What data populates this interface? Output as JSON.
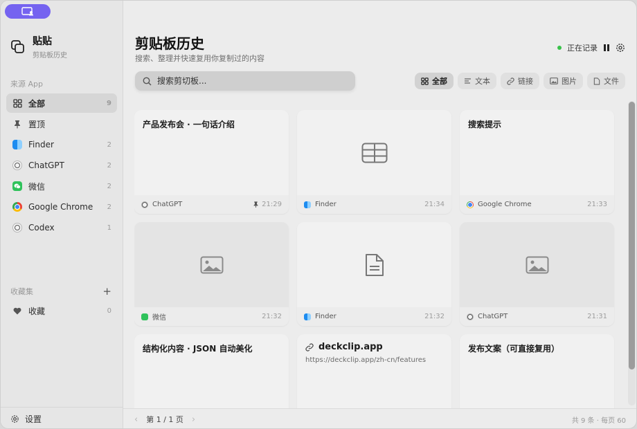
{
  "sidebar": {
    "brand": {
      "title": "贴贴",
      "subtitle": "剪贴板历史"
    },
    "sources_label": "来源 App",
    "items": [
      {
        "label": "全部",
        "count": "9",
        "icon": "grid-icon"
      },
      {
        "label": "置顶",
        "count": "",
        "icon": "pin-icon"
      },
      {
        "label": "Finder",
        "count": "2",
        "icon": "finder-icon"
      },
      {
        "label": "ChatGPT",
        "count": "2",
        "icon": "chatgpt-icon"
      },
      {
        "label": "微信",
        "count": "2",
        "icon": "wechat-icon"
      },
      {
        "label": "Google Chrome",
        "count": "2",
        "icon": "chrome-icon"
      },
      {
        "label": "Codex",
        "count": "1",
        "icon": "codex-icon"
      }
    ],
    "collections_label": "收藏集",
    "collections": [
      {
        "label": "收藏",
        "count": "0",
        "icon": "heart-icon"
      }
    ],
    "settings_label": "设置"
  },
  "header": {
    "title": "剪贴板历史",
    "subtitle": "搜索、整理并快速复用你复制过的内容",
    "status": "正在记录"
  },
  "search": {
    "placeholder": "搜索剪切板..."
  },
  "filters": [
    {
      "label": "全部",
      "icon": "grid-icon"
    },
    {
      "label": "文本",
      "icon": "text-icon"
    },
    {
      "label": "链接",
      "icon": "link-icon"
    },
    {
      "label": "图片",
      "icon": "image-icon"
    },
    {
      "label": "文件",
      "icon": "file-icon"
    }
  ],
  "cards": [
    {
      "title": "产品发布会 · 一句话介绍",
      "app": "ChatGPT",
      "time": "21:29",
      "pinned": true
    },
    {
      "title": "",
      "app": "Finder",
      "time": "21:34",
      "preview": "table-icon"
    },
    {
      "title": "搜索提示",
      "app": "Google Chrome",
      "time": "21:33"
    },
    {
      "title": "",
      "app": "微信",
      "time": "21:32",
      "preview": "image-icon"
    },
    {
      "title": "",
      "app": "Finder",
      "time": "21:32",
      "preview": "document-icon"
    },
    {
      "title": "",
      "app": "ChatGPT",
      "time": "21:31",
      "preview": "image-icon"
    },
    {
      "title": "结构化内容 · JSON 自动美化"
    },
    {
      "title": "deckclip.app",
      "url": "https://deckclip.app/zh-cn/features"
    },
    {
      "title": "发布文案（可直接复用）"
    }
  ],
  "footer": {
    "page": "第 1 / 1 页",
    "summary": "共 9 条 · 每页 60"
  },
  "colors": {
    "accent": "#7563f0",
    "recording": "#39c24a"
  }
}
